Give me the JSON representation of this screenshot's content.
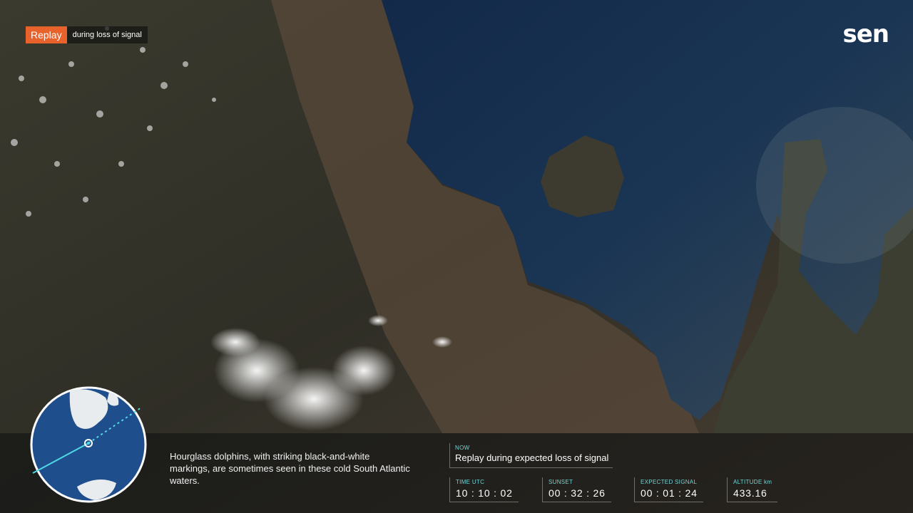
{
  "replay": {
    "tag": "Replay",
    "text": "during loss of signal"
  },
  "logo": {
    "text": "sen"
  },
  "caption": "Hourglass dolphins, with striking black-and-white markings, are sometimes seen in these cold South Atlantic waters.",
  "now": {
    "label": "NOW",
    "value": "Replay during expected loss of signal"
  },
  "stats": {
    "time_utc": {
      "label": "TIME UTC",
      "value": "10 : 10 : 02"
    },
    "sunset": {
      "label": "SUNSET",
      "value": "00 : 32 : 26"
    },
    "expected_signal": {
      "label": "EXPECTED SIGNAL",
      "value": "00 : 01 : 24"
    },
    "altitude": {
      "label": "ALTITUDE km",
      "value": "433.16"
    }
  },
  "colors": {
    "accent_orange": "#e8632b",
    "label_cyan": "#6fd6d6",
    "ocean_globe": "#1f4e8c",
    "orbit_line": "#4fd8e8"
  },
  "icons": {
    "globe": "orbit-globe-icon"
  }
}
